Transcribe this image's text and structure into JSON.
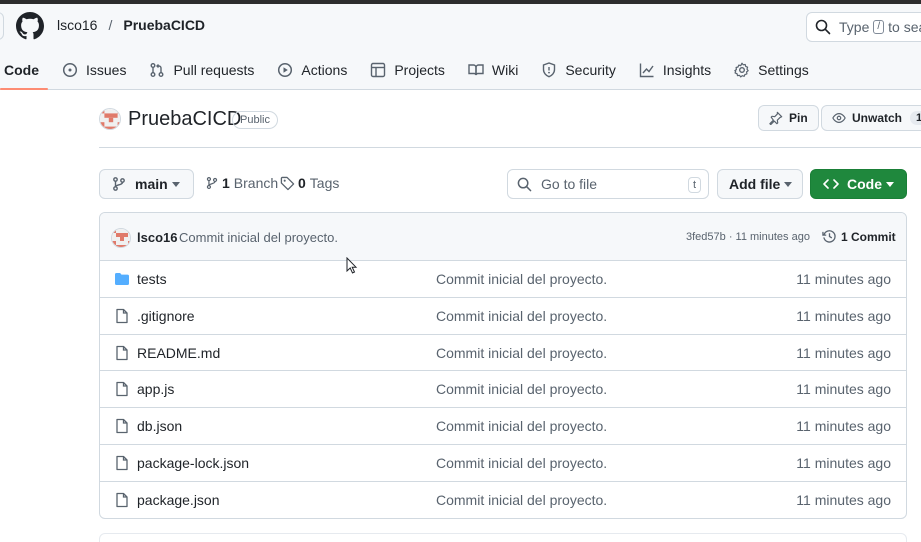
{
  "colors": {
    "accent_underline": "#fd8c73",
    "code_button_bg": "#1f883d",
    "folder_icon": "#54aeff",
    "muted_text": "#59636e"
  },
  "header": {
    "owner": "lsco16",
    "separator": "/",
    "repo": "PruebaCICD",
    "search": {
      "prefix": "Type",
      "key": "/",
      "suffix": "to search"
    }
  },
  "tabs": [
    {
      "label": "Code",
      "icon": "code-icon",
      "selected": true
    },
    {
      "label": "Issues",
      "icon": "issue-icon"
    },
    {
      "label": "Pull requests",
      "icon": "pull-request-icon"
    },
    {
      "label": "Actions",
      "icon": "play-icon"
    },
    {
      "label": "Projects",
      "icon": "table-icon"
    },
    {
      "label": "Wiki",
      "icon": "book-icon"
    },
    {
      "label": "Security",
      "icon": "shield-icon"
    },
    {
      "label": "Insights",
      "icon": "graph-icon"
    },
    {
      "label": "Settings",
      "icon": "gear-icon"
    }
  ],
  "repo": {
    "name": "PruebaCICD",
    "visibility": "Public",
    "pin_label": "Pin",
    "watch_label": "Unwatch",
    "watch_count": "1"
  },
  "toolbar": {
    "branch": "main",
    "branches_count": "1",
    "branches_label": "Branch",
    "tags_count": "0",
    "tags_label": "Tags",
    "goto_placeholder": "Go to file",
    "goto_key": "t",
    "add_file_label": "Add file",
    "code_label": "Code"
  },
  "latest_commit": {
    "author": "lsco16",
    "message": "Commit inicial del proyecto.",
    "hash": "3fed57b",
    "separator": " · ",
    "age": "11 minutes ago",
    "commit_count_label": "1 Commit"
  },
  "files": [
    {
      "name": "tests",
      "type": "folder",
      "message": "Commit inicial del proyecto.",
      "age": "11 minutes ago"
    },
    {
      "name": ".gitignore",
      "type": "file",
      "message": "Commit inicial del proyecto.",
      "age": "11 minutes ago"
    },
    {
      "name": "README.md",
      "type": "file",
      "message": "Commit inicial del proyecto.",
      "age": "11 minutes ago"
    },
    {
      "name": "app.js",
      "type": "file",
      "message": "Commit inicial del proyecto.",
      "age": "11 minutes ago"
    },
    {
      "name": "db.json",
      "type": "file",
      "message": "Commit inicial del proyecto.",
      "age": "11 minutes ago"
    },
    {
      "name": "package-lock.json",
      "type": "file",
      "message": "Commit inicial del proyecto.",
      "age": "11 minutes ago"
    },
    {
      "name": "package.json",
      "type": "file",
      "message": "Commit inicial del proyecto.",
      "age": "11 minutes ago"
    }
  ]
}
